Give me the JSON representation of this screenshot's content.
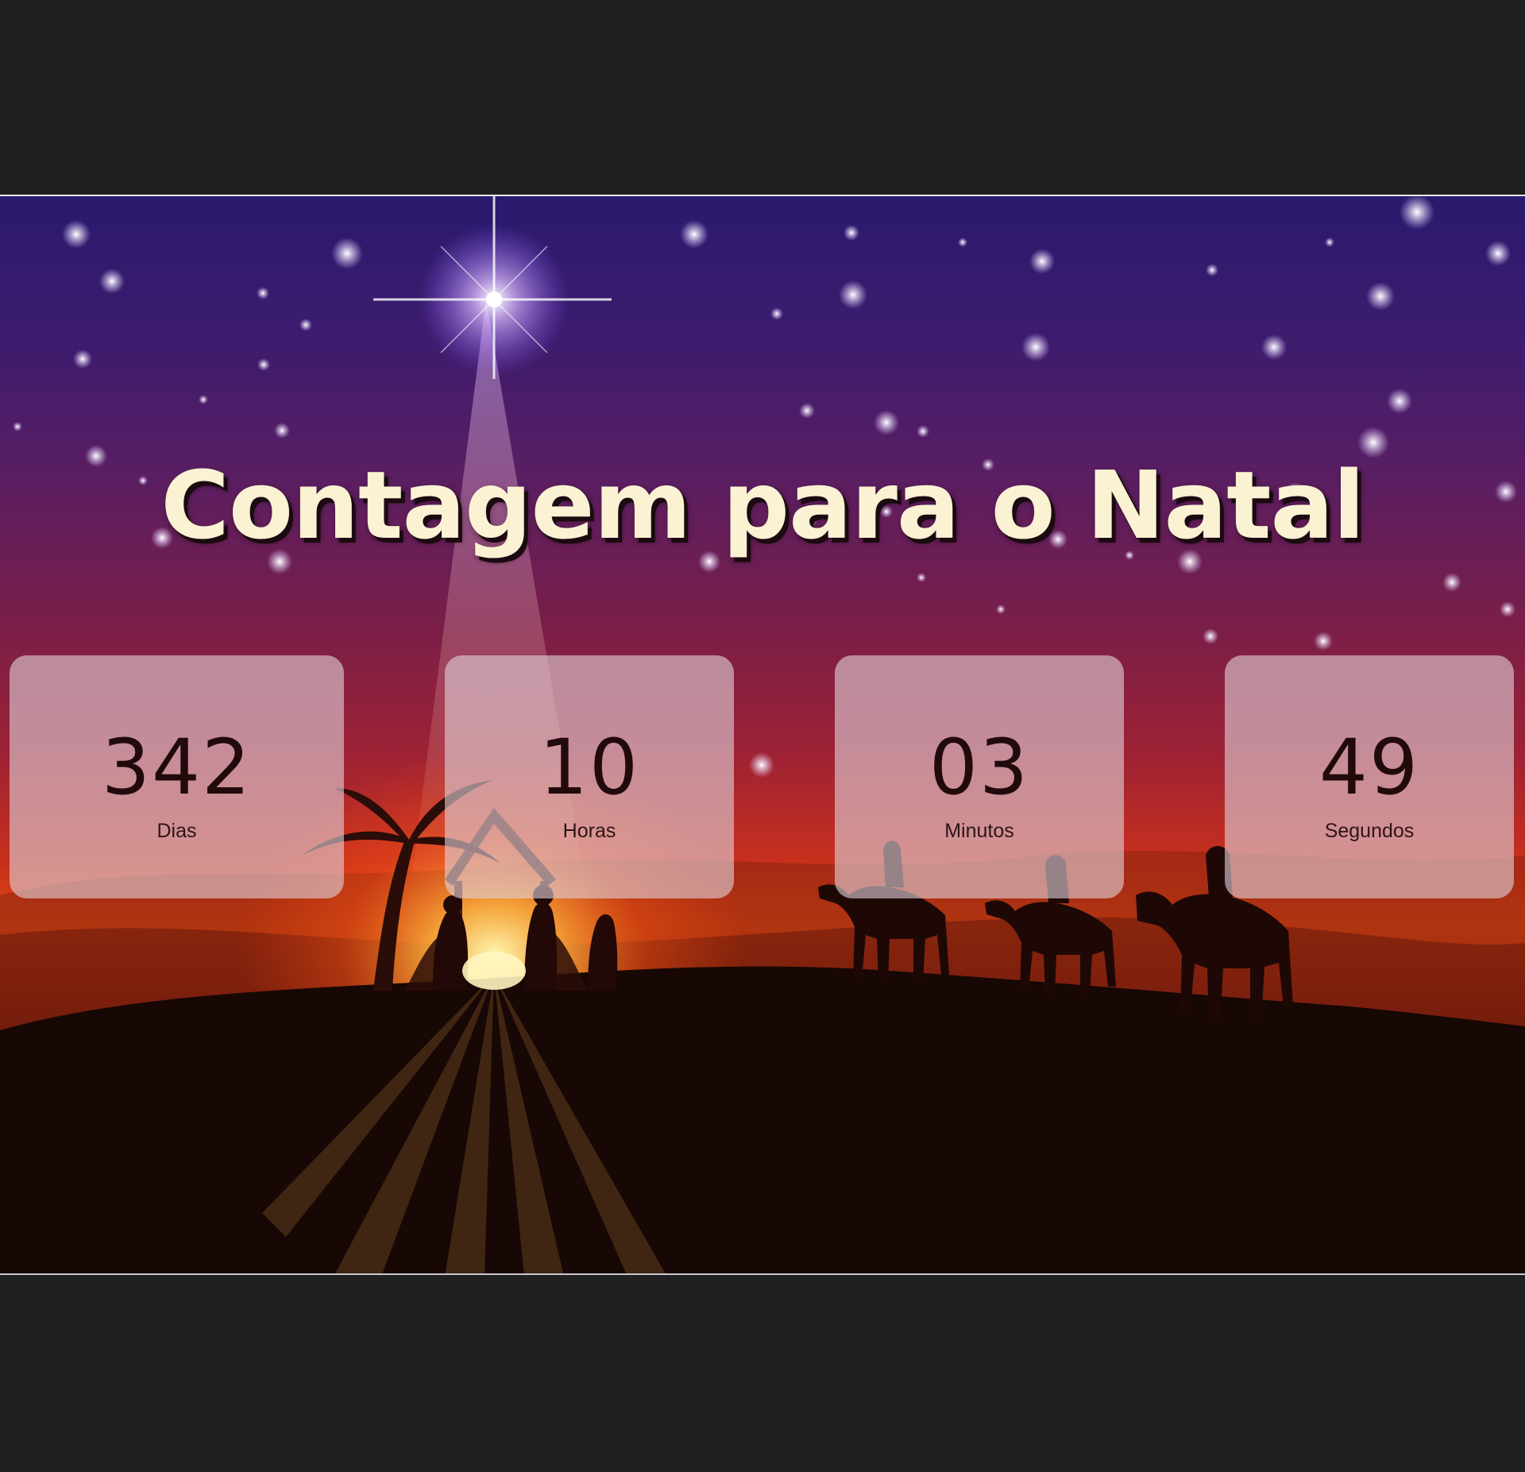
{
  "header": {
    "title": "Contagem para o Natal"
  },
  "countdown": [
    {
      "id": "days",
      "value": "342",
      "label": "Dias"
    },
    {
      "id": "hours",
      "value": "10",
      "label": "Horas"
    },
    {
      "id": "minutes",
      "value": "03",
      "label": "Minutos"
    },
    {
      "id": "seconds",
      "value": "49",
      "label": "Segundos"
    }
  ],
  "background": {
    "image": "nativity-scene-silhouette",
    "colors": {
      "sky_top": "#2a1a6e",
      "sky_mid": "#7a1e48",
      "horizon_glow": "#e04a10",
      "ground": "#160604",
      "title_text": "#fbf2d4",
      "card": "#dececd"
    }
  }
}
